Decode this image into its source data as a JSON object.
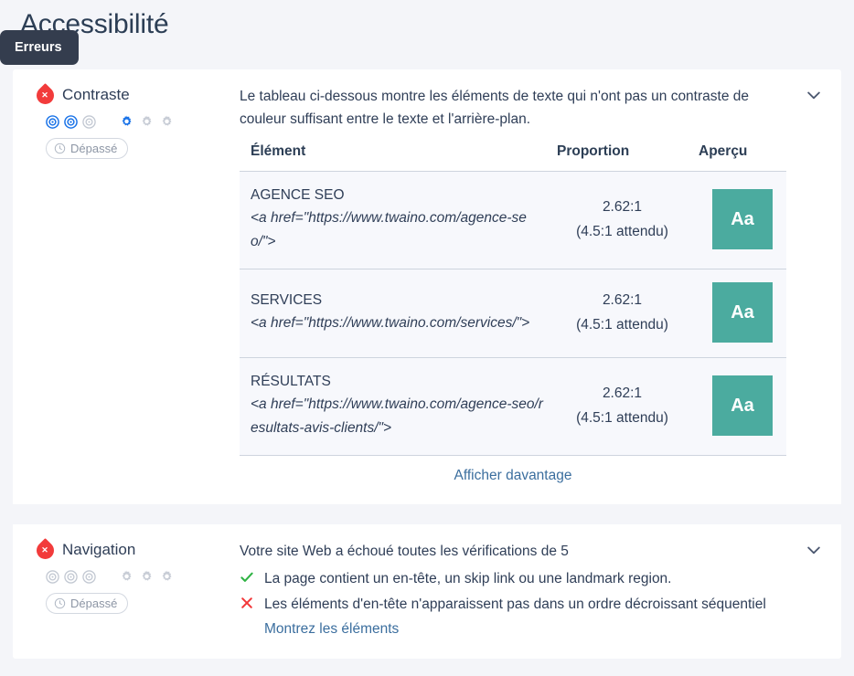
{
  "header": {
    "title": "Accessibilité"
  },
  "tooltip": {
    "label": "Erreurs"
  },
  "sections": [
    {
      "id": "contraste",
      "title": "Contraste",
      "status_icon": "error-icon",
      "impact_active": 2,
      "impact_total": 3,
      "effort_active": 1,
      "effort_total": 3,
      "badge": {
        "label": "Dépassé",
        "icon": "clock-icon"
      },
      "description": "Le tableau ci-dessous montre les éléments de texte qui n'ont pas un contraste de couleur suffisant entre le texte et l'arrière-plan.",
      "table": {
        "columns": [
          "Élément",
          "Proportion",
          "Aperçu"
        ],
        "rows": [
          {
            "element_name": "AGENCE SEO",
            "element_code": "<a href=\"https://www.twaino.com/agence-seo/\">",
            "ratio": "2.62:1",
            "expected": "(4.5:1 attendu)",
            "preview_text": "Aa",
            "preview_color": "#4bab9f"
          },
          {
            "element_name": "SERVICES",
            "element_code": "<a href=\"https://www.twaino.com/services/\">",
            "ratio": "2.62:1",
            "expected": "(4.5:1 attendu)",
            "preview_text": "Aa",
            "preview_color": "#4bab9f"
          },
          {
            "element_name": "RÉSULTATS",
            "element_code": "<a href=\"https://www.twaino.com/agence-seo/resultats-avis-clients/\">",
            "ratio": "2.62:1",
            "expected": "(4.5:1 attendu)",
            "preview_text": "Aa",
            "preview_color": "#4bab9f"
          }
        ]
      },
      "show_more_label": "Afficher davantage",
      "collapse_icon": "chevron-down-icon"
    },
    {
      "id": "navigation",
      "title": "Navigation",
      "status_icon": "error-icon",
      "impact_active": 0,
      "impact_total": 3,
      "effort_active": 0,
      "effort_total": 3,
      "badge": {
        "label": "Dépassé",
        "icon": "clock-icon"
      },
      "description": "Votre site Web a échoué toutes les vérifications de 5",
      "checks": [
        {
          "state": "pass",
          "icon": "check-icon",
          "text": "La page contient un en-tête, un skip link ou une landmark region."
        },
        {
          "state": "fail",
          "icon": "x-icon",
          "text": "Les éléments d'en-tête n'apparaissent pas dans un ordre décroissant séquentiel",
          "link_label": "Montrez les éléments"
        }
      ],
      "collapse_icon": "chevron-down-icon"
    }
  ],
  "colors": {
    "error_red": "#f23b3b",
    "success_green": "#2fb344",
    "accent_blue": "#1a73e8",
    "link_blue": "#3b6e9e",
    "icon_gray": "#c2c8d2",
    "teal_swatch": "#4bab9f",
    "tooltip_bg": "#343d4e",
    "page_bg": "#f4f5f9"
  }
}
